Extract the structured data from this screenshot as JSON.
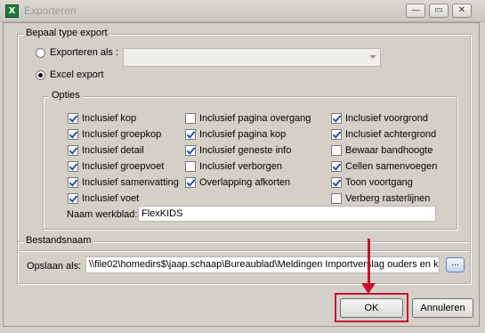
{
  "window": {
    "title": "Exporteren",
    "app_icon": "X",
    "minimize": "—",
    "maximize": "▭",
    "close": "✕"
  },
  "bepaal_type": {
    "group_label": "Bepaal type export",
    "exporteren_als": {
      "label": "Exporteren als :",
      "checked": false,
      "value": ""
    },
    "excel_export": {
      "label": "Excel export",
      "checked": true
    }
  },
  "opties": {
    "group_label": "Opties",
    "checkboxes": [
      {
        "label": "Inclusief kop",
        "checked": true
      },
      {
        "label": "Inclusief groepkop",
        "checked": true
      },
      {
        "label": "Inclusief detail",
        "checked": true
      },
      {
        "label": "Inclusief groepvoet",
        "checked": true
      },
      {
        "label": "Inclusief samenvatting",
        "checked": true
      },
      {
        "label": "Inclusief voet",
        "checked": true
      },
      {
        "label": "Inclusief pagina overgang",
        "checked": false
      },
      {
        "label": "Inclusief pagina kop",
        "checked": true
      },
      {
        "label": "Inclusief geneste info",
        "checked": true
      },
      {
        "label": "Inclusief verborgen",
        "checked": false
      },
      {
        "label": "Overlapping afkorten",
        "checked": true
      },
      {
        "label": "Inclusief voorgrond",
        "checked": true
      },
      {
        "label": "Inclusief achtergrond",
        "checked": true
      },
      {
        "label": "Bewaar bandhoogte",
        "checked": false
      },
      {
        "label": "Cellen samenvoegen",
        "checked": true
      },
      {
        "label": "Toon voortgang",
        "checked": true
      },
      {
        "label": "Verberg rasterlijnen",
        "checked": false
      }
    ],
    "naam_werkblad": {
      "label": "Naam werkblad:",
      "value": "FlexKIDS"
    }
  },
  "bestandsnaam": {
    "group_label": "Bestandsnaam",
    "opslaan_als": {
      "label": "Opslaan als:",
      "value": "\\\\file02\\homedirs$\\jaap.schaap\\Bureaublad\\Meldingen Importverslag ouders en k"
    },
    "browse_label": "..."
  },
  "buttons": {
    "ok": "OK",
    "cancel": "Annuleren"
  },
  "annotation": {
    "color": "#c8102e"
  }
}
